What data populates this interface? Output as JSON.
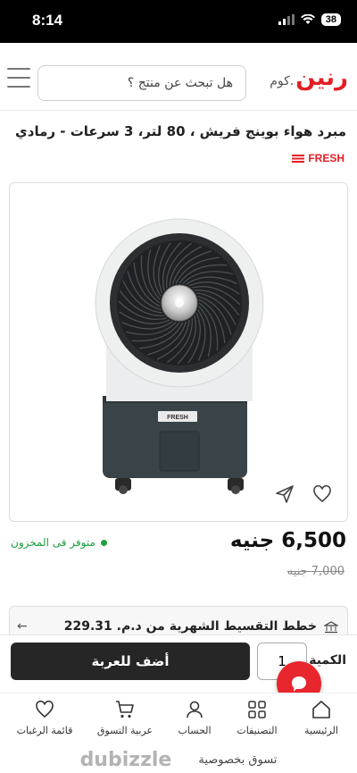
{
  "status_bar": {
    "time": "8:14",
    "battery": "38"
  },
  "header": {
    "logo_main": "رنين",
    "logo_suffix": ".كوم",
    "search_placeholder": "هل تبحث عن منتج ؟"
  },
  "product": {
    "title": "مبرد هواء بوينج فريش ، 80 لتر، 3 سرعات - رمادي",
    "brand": "FRESH",
    "image_brand_label": "FRESH",
    "stock_status": "متوفر فى المخزون",
    "price": "6,500 جنيه",
    "old_price": "7,000 جنيه"
  },
  "installment": {
    "text": "خطط التقسيط الشهرية من د.م. 229.31"
  },
  "purchase": {
    "quantity_label": "الكمية",
    "quantity_value": "1",
    "add_to_cart_label": "أضف للعربة"
  },
  "bottom_nav": [
    {
      "label": "الرئيسية",
      "icon": "home-icon"
    },
    {
      "label": "التصنيفات",
      "icon": "grid-icon"
    },
    {
      "label": "الحساب",
      "icon": "user-icon"
    },
    {
      "label": "عربية التسوق",
      "icon": "cart-icon"
    },
    {
      "label": "قائمة الرغبات",
      "icon": "heart-icon"
    }
  ],
  "footer": {
    "privacy_text": "تسوق بخصوصية",
    "watermark": "dubizzle"
  },
  "colors": {
    "brand_red": "#e31e24",
    "in_stock_green": "#1c9f3d",
    "cta_dark": "#262626",
    "chat_red": "#e8262d"
  }
}
